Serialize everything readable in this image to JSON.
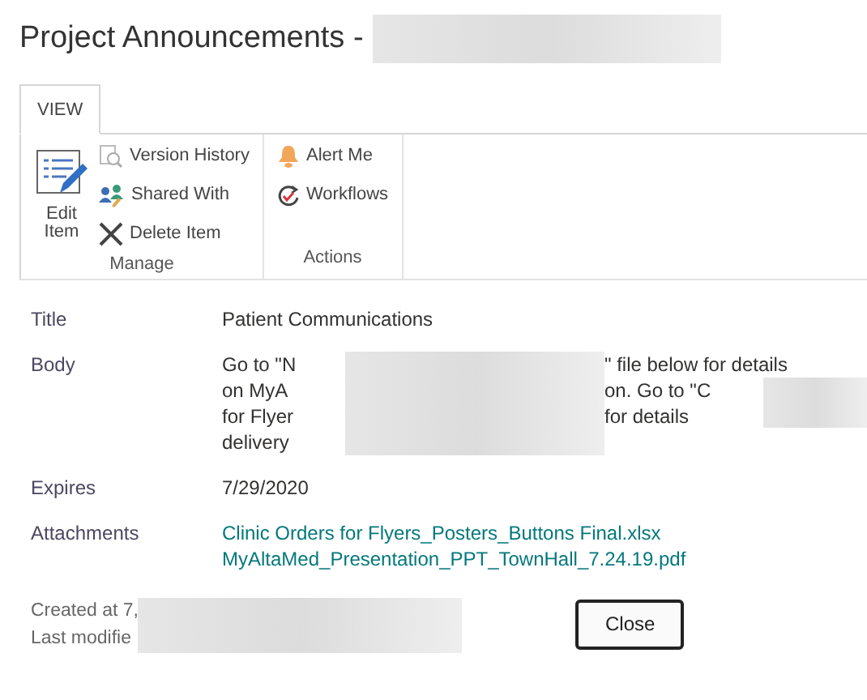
{
  "page_title": "Project Announcements -",
  "ribbon": {
    "tabs": [
      {
        "label": "VIEW",
        "selected": true
      }
    ],
    "groups": [
      {
        "label": "Manage",
        "large": {
          "label": "Edit Item",
          "kind": "edit"
        },
        "items": [
          {
            "label": "Version History",
            "kind": "history"
          },
          {
            "label": "Shared With",
            "kind": "people"
          },
          {
            "label": "Delete Item",
            "kind": "delete"
          }
        ]
      },
      {
        "label": "Actions",
        "items": [
          {
            "label": "Alert Me",
            "kind": "bell"
          },
          {
            "label": "Workflows",
            "kind": "workflow"
          }
        ]
      }
    ]
  },
  "fields": [
    {
      "kind": "text",
      "label": "Title",
      "value": "Patient Communications"
    },
    {
      "kind": "body",
      "label": "Body",
      "lines": [
        {
          "before": "Go to \"N",
          "after": "\" file below for details"
        },
        {
          "before": "on MyA",
          "after": "on. Go to \"C"
        },
        {
          "before": "for Flyer",
          "after": "for details"
        },
        {
          "before": "delivery"
        }
      ]
    },
    {
      "kind": "text",
      "label": "Expires",
      "value": "7/29/2020"
    },
    {
      "kind": "attachments",
      "label": "Attachments",
      "files": [
        "Clinic Orders for Flyers_Posters_Buttons Final.xlsx",
        "MyAltaMed_Presentation_PPT_TownHall_7.24.19.pdf"
      ]
    }
  ],
  "footer": {
    "created": "Created at 7,",
    "modified": "Last modifie"
  },
  "close_button": "Close"
}
